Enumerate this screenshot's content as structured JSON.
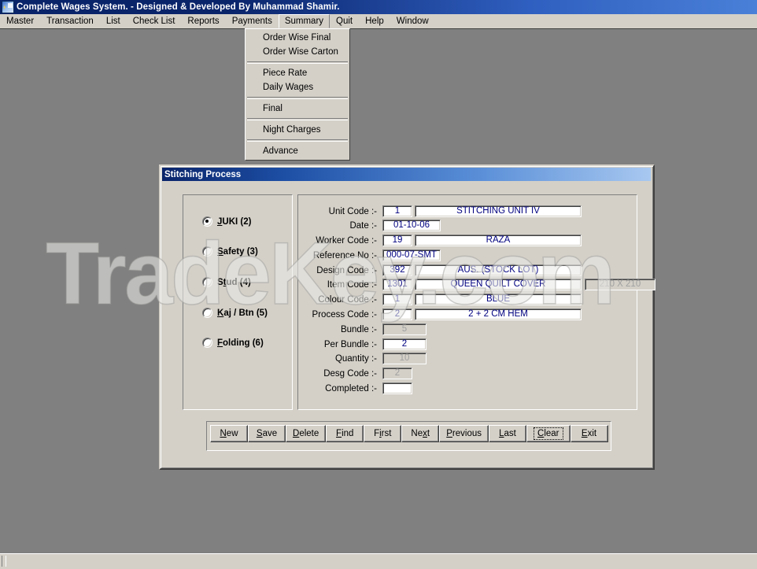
{
  "window": {
    "title": "Complete Wages System. - Designed & Developed By Muhammad Shamir.",
    "icon": "app-icon"
  },
  "menubar": {
    "items": [
      {
        "label": "Master",
        "open": false
      },
      {
        "label": "Transaction",
        "open": false
      },
      {
        "label": "List",
        "open": false
      },
      {
        "label": "Check List",
        "open": false
      },
      {
        "label": "Reports",
        "open": false
      },
      {
        "label": "Payments",
        "open": false
      },
      {
        "label": "Summary",
        "open": true
      },
      {
        "label": "Quit",
        "open": false
      },
      {
        "label": "Help",
        "open": false
      },
      {
        "label": "Window",
        "open": false
      }
    ]
  },
  "dropdown": {
    "owner": "Summary",
    "items": [
      {
        "label": "Order Wise Final",
        "separator_after": false
      },
      {
        "label": "Order Wise Carton",
        "separator_after": true
      },
      {
        "label": "Piece Rate",
        "separator_after": false
      },
      {
        "label": "Daily Wages",
        "separator_after": true
      },
      {
        "label": "Final",
        "separator_after": true
      },
      {
        "label": "Night Charges",
        "separator_after": true
      },
      {
        "label": "Advance",
        "separator_after": false
      }
    ]
  },
  "child_window": {
    "title": "Stitching Process"
  },
  "machine_options": {
    "selected": "JUKI (2)",
    "items": [
      {
        "label": "JUKI (2)",
        "accel": "J",
        "selected": true
      },
      {
        "label": "Safety (3)",
        "accel": "S",
        "selected": false
      },
      {
        "label": "Stud (4)",
        "accel": "t",
        "selected": false
      },
      {
        "label": "Kaj / Btn (5)",
        "accel": "K",
        "selected": false
      },
      {
        "label": "Folding (6)",
        "accel": "F",
        "selected": false
      }
    ]
  },
  "form": {
    "unit_code": {
      "label": "Unit Code :-",
      "code": "1",
      "description": "STITCHING UNIT IV"
    },
    "date": {
      "label": "Date :-",
      "value": "01-10-06"
    },
    "worker_code": {
      "label": "Worker Code :-",
      "code": "19",
      "description": "RAZA"
    },
    "reference_no": {
      "label": "Reference No :-",
      "value": "000-07-SMT"
    },
    "design_code": {
      "label": "Design Code :-",
      "code": "392",
      "description": "AUS. (STOCK LOT)"
    },
    "item_code": {
      "label": "Item Code :-",
      "code": "1301",
      "description": "QUEEN QUILT COVER",
      "size": "210 X 210"
    },
    "colour_code": {
      "label": "Colour Code :-",
      "code": "1",
      "description": "BLUE"
    },
    "process_code": {
      "label": "Process Code :-",
      "code": "2",
      "description": "2 + 2 CM HEM"
    },
    "bundle": {
      "label": "Bundle :-",
      "value": "5",
      "disabled": true
    },
    "per_bundle": {
      "label": "Per Bundle :-",
      "value": "2",
      "disabled": false
    },
    "quantity": {
      "label": "Quantity :-",
      "value": "10",
      "disabled": true
    },
    "desg_code": {
      "label": "Desg Code :-",
      "value": "2",
      "disabled": true
    },
    "completed": {
      "label": "Completed :-",
      "value": "",
      "disabled": false
    }
  },
  "buttons": [
    {
      "label": "New",
      "accel": "N",
      "focused": false
    },
    {
      "label": "Save",
      "accel": "S",
      "focused": false
    },
    {
      "label": "Delete",
      "accel": "D",
      "focused": false
    },
    {
      "label": "Find",
      "accel": "F",
      "focused": false
    },
    {
      "label": "First",
      "accel": "i",
      "focused": false
    },
    {
      "label": "Next",
      "accel": "x",
      "focused": false
    },
    {
      "label": "Previous",
      "accel": "P",
      "focused": false
    },
    {
      "label": "Last",
      "accel": "L",
      "focused": false
    },
    {
      "label": "Clear",
      "accel": "C",
      "focused": true
    },
    {
      "label": "Exit",
      "accel": "E",
      "focused": false
    }
  ],
  "watermark": {
    "text": "TradeKey.com"
  }
}
